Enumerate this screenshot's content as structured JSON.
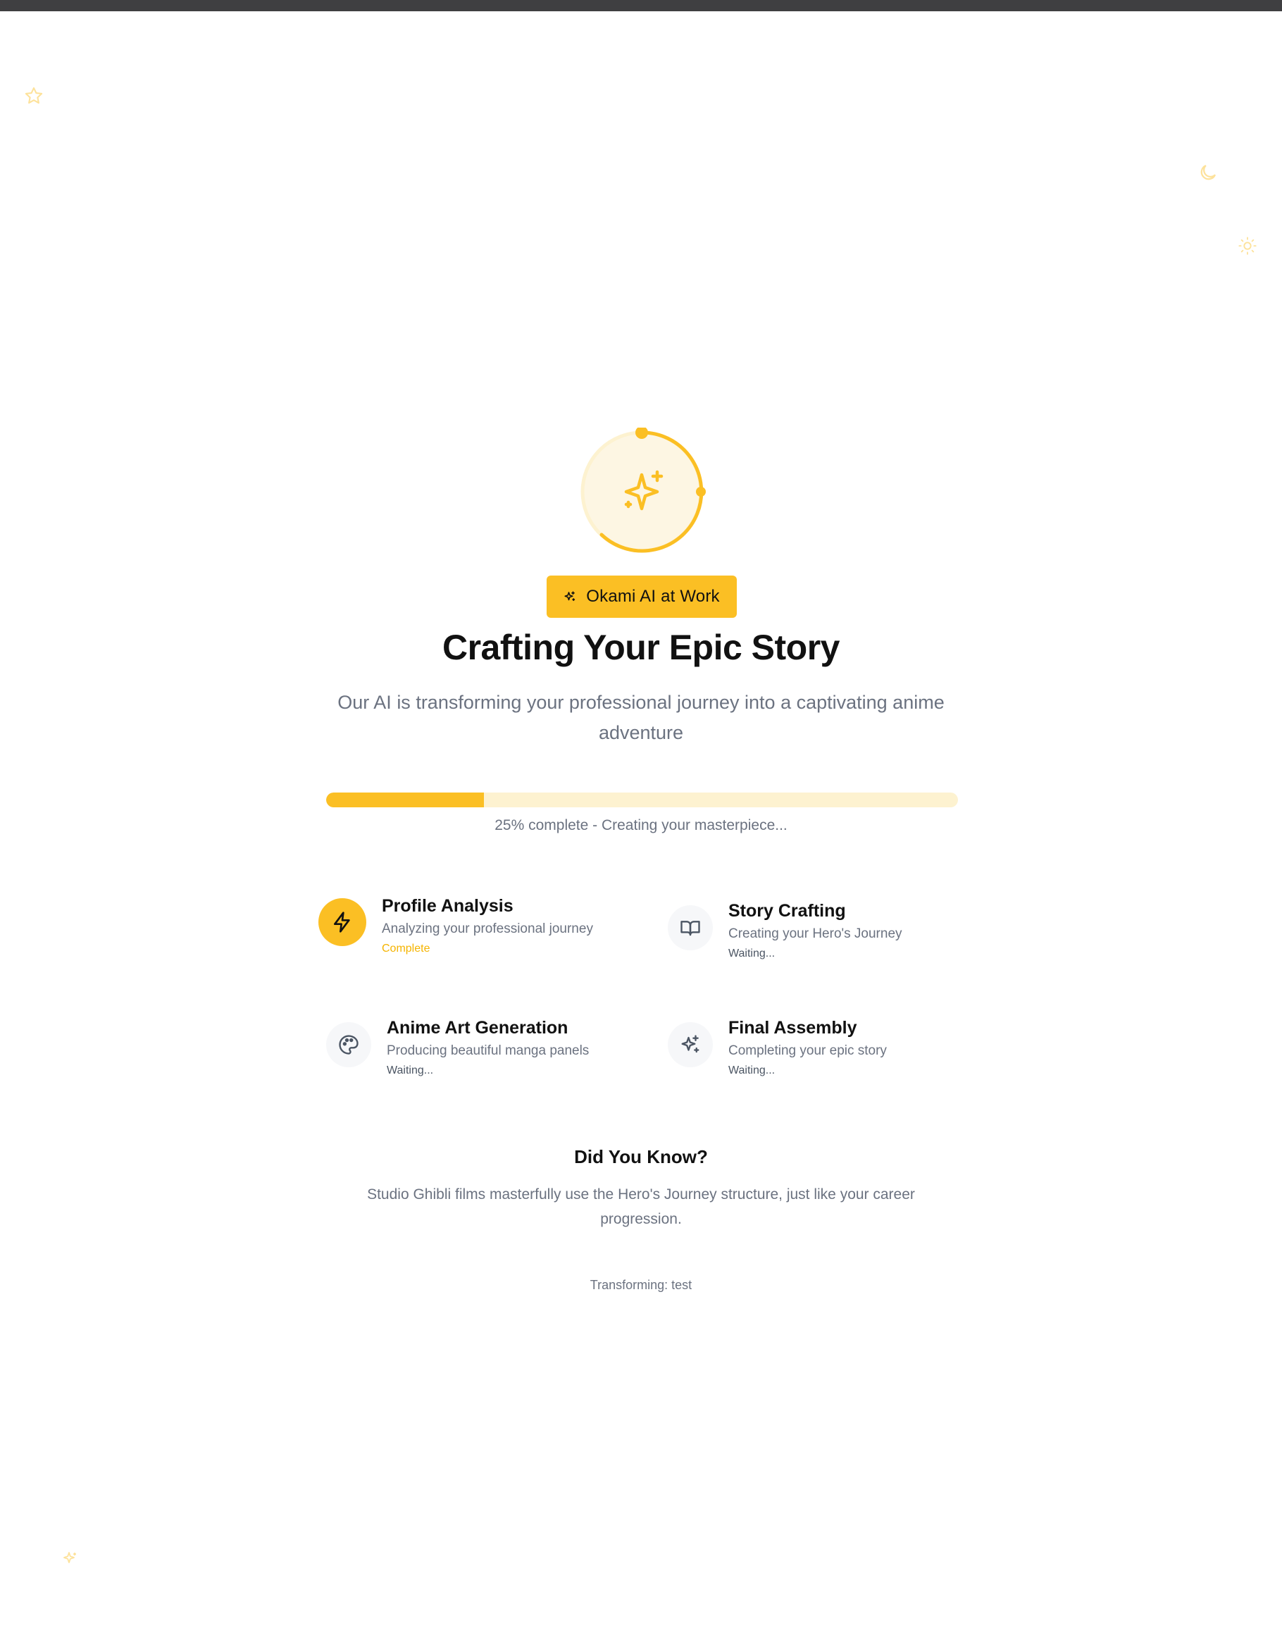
{
  "badge": {
    "label": "Okami AI at Work",
    "icon": "sparkles-icon"
  },
  "hero": {
    "title": "Crafting Your Epic Story",
    "subtitle": "Our AI is transforming your professional journey into a captivating anime adventure"
  },
  "progress": {
    "percent": 25,
    "text": "25% complete - Creating your masterpiece..."
  },
  "steps": [
    {
      "title": "Profile Analysis",
      "description": "Analyzing your professional journey",
      "status": "Complete",
      "icon": "lightning-icon"
    },
    {
      "title": "Story Crafting",
      "description": "Creating your Hero's Journey",
      "status": "Waiting...",
      "icon": "book-open-icon"
    },
    {
      "title": "Anime Art Generation",
      "description": "Producing beautiful manga panels",
      "status": "Waiting...",
      "icon": "palette-icon"
    },
    {
      "title": "Final Assembly",
      "description": "Completing your epic story",
      "status": "Waiting...",
      "icon": "sparkles-icon"
    }
  ],
  "did_you_know": {
    "title": "Did You Know?",
    "text": "Studio Ghibli films masterfully use the Hero's Journey structure, just like your career progression."
  },
  "footer": {
    "text": "Transforming: test"
  },
  "colors": {
    "accent": "#fbbf24",
    "accent_light": "#fdf2d0",
    "muted_text": "#6b7280",
    "heading": "#111111"
  }
}
